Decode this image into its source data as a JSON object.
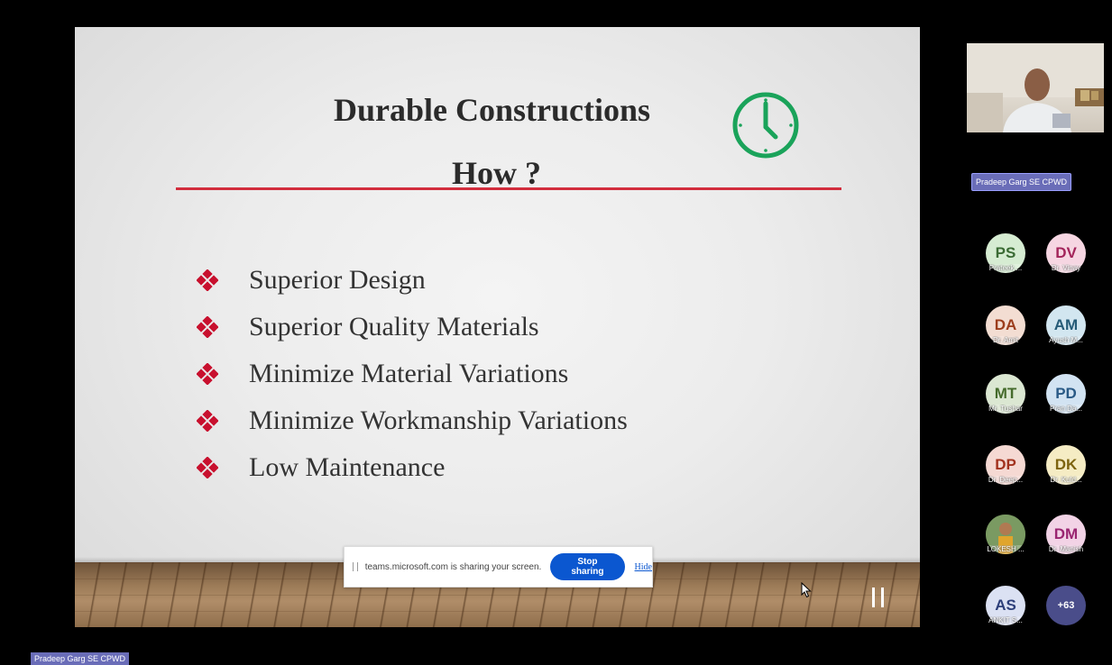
{
  "slide": {
    "title": "Durable Constructions",
    "subtitle": "How ?",
    "bullets": [
      "Superior Design",
      "Superior Quality Materials",
      "Minimize Material Variations",
      "Minimize Workmanship Variations",
      "Low Maintenance"
    ],
    "colors": {
      "rule": "#d22d3d",
      "bullet": "#c8102e",
      "clock": "#1aa35a"
    }
  },
  "share_bar": {
    "message": "teams.microsoft.com is sharing your screen.",
    "stop_label": "Stop sharing",
    "hide_label": "Hide"
  },
  "presenter": {
    "name": "Pradeep Garg SE CPWD"
  },
  "participants": [
    {
      "initials": "PS",
      "name": "Prateek ...",
      "bg": "#d6ecd2",
      "fg": "#3b6b34"
    },
    {
      "initials": "DV",
      "name": "Dr. Vinay",
      "bg": "#f6d6e2",
      "fg": "#a3245a"
    },
    {
      "initials": "DA",
      "name": "Dr. Amit",
      "bg": "#f3ddd2",
      "fg": "#9c3d1c"
    },
    {
      "initials": "AM",
      "name": "Ayush M...",
      "bg": "#d2e6f0",
      "fg": "#255b77"
    },
    {
      "initials": "MT",
      "name": "Mr. Tushar",
      "bg": "#dbe7d2",
      "fg": "#456b2c"
    },
    {
      "initials": "PD",
      "name": "Pran Da...",
      "bg": "#d2e3f2",
      "fg": "#2a5a86"
    },
    {
      "initials": "DP",
      "name": "Dr. Deep...",
      "bg": "#f5d9d3",
      "fg": "#a2321e"
    },
    {
      "initials": "DK",
      "name": "Dr. Kuld...",
      "bg": "#f5ecc4",
      "fg": "#7d6410"
    },
    {
      "initials": "",
      "name": "LOKESH ...",
      "bg": "#6b8a55",
      "fg": "#ffffff"
    },
    {
      "initials": "DM",
      "name": "Dr. Manish",
      "bg": "#f2d3e6",
      "fg": "#9a2571"
    },
    {
      "initials": "AS",
      "name": "ANKIT S...",
      "bg": "#dbe1f3",
      "fg": "#2d3f7a"
    },
    {
      "initials": "+63",
      "name": "",
      "bg": "#4a4d8a",
      "fg": "#ffffff"
    }
  ],
  "bottom_label": "Pradeep Garg SE CPWD"
}
